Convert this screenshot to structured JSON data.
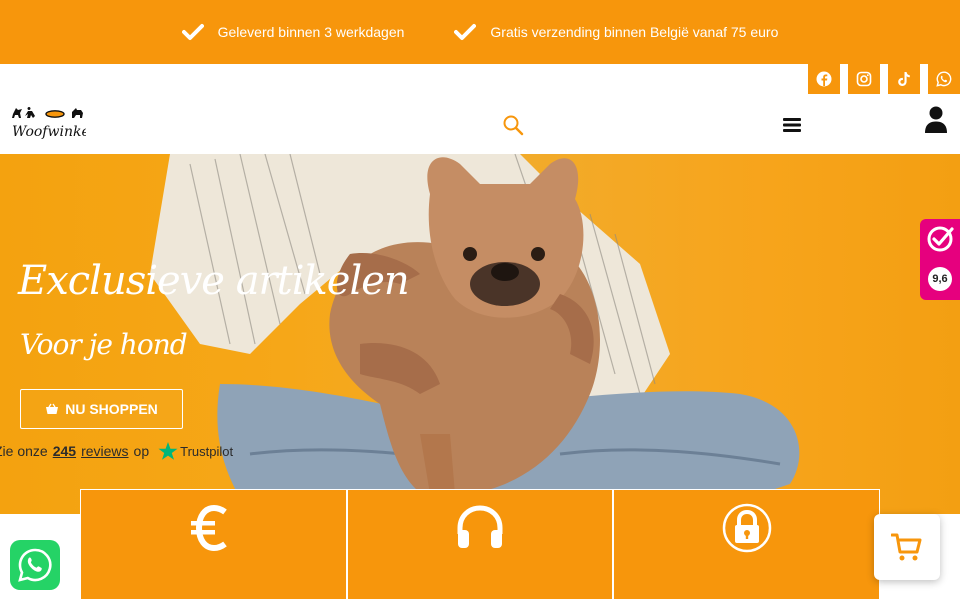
{
  "topbar": {
    "usps": [
      {
        "icon": "check-icon",
        "text": "Geleverd binnen 3 werkdagen"
      },
      {
        "icon": "check-icon",
        "text": "Gratis verzending binnen België vanaf 75 euro"
      }
    ]
  },
  "header": {
    "logo_text": "Woofwinkel",
    "socials": [
      "facebook-icon",
      "instagram-icon",
      "tiktok-icon",
      "whatsapp-icon"
    ],
    "icons": [
      "search-icon",
      "menu-icon",
      "user-icon"
    ]
  },
  "hero": {
    "title": "Exclusieve artikelen",
    "subtitle": "Voor je hond",
    "cta_label": "NU SHOPPEN",
    "reviews_prefix": "Zie onze",
    "reviews_count": "245",
    "reviews_word": "reviews",
    "reviews_on": "op",
    "reviews_brand": "Trustpilot"
  },
  "rating_widget": {
    "score": "9,6"
  },
  "features": [
    {
      "icon": "euro-icon"
    },
    {
      "icon": "headphones-icon"
    },
    {
      "icon": "lock-icon"
    }
  ],
  "colors": {
    "accent": "#f7960c",
    "rating_pink": "#e6007e",
    "whatsapp_green": "#25d366",
    "trustpilot_green": "#00b67a"
  }
}
